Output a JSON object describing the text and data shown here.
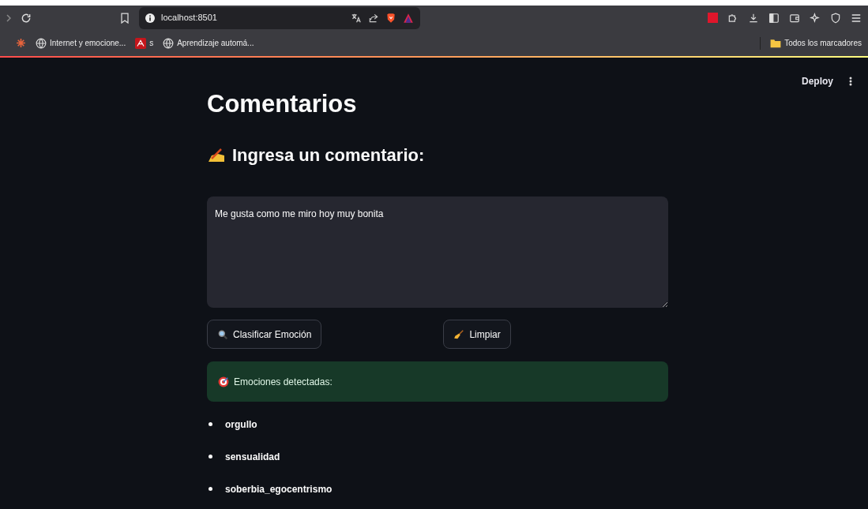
{
  "browser": {
    "url": "localhost:8501",
    "bookmarks": [
      {
        "kind": "site",
        "label": "Internet y emocione..."
      },
      {
        "kind": "pdf",
        "label": "s"
      },
      {
        "kind": "site",
        "label": "Aprendizaje automá..."
      }
    ],
    "all_bookmarks": "Todos los marcadores"
  },
  "header": {
    "deploy": "Deploy"
  },
  "title": "Comentarios",
  "subheader": "Ingresa un comentario:",
  "comment": {
    "value": "Me gusta como me miro hoy muy bonita"
  },
  "buttons": [
    {
      "kind": "search",
      "label": "Clasificar Emoción"
    },
    {
      "kind": "broom",
      "label": "Limpiar"
    }
  ],
  "result": {
    "label": "Emociones detectadas:"
  },
  "emotions": [
    "orgullo",
    "sensualidad",
    "soberbia_egocentrismo"
  ]
}
